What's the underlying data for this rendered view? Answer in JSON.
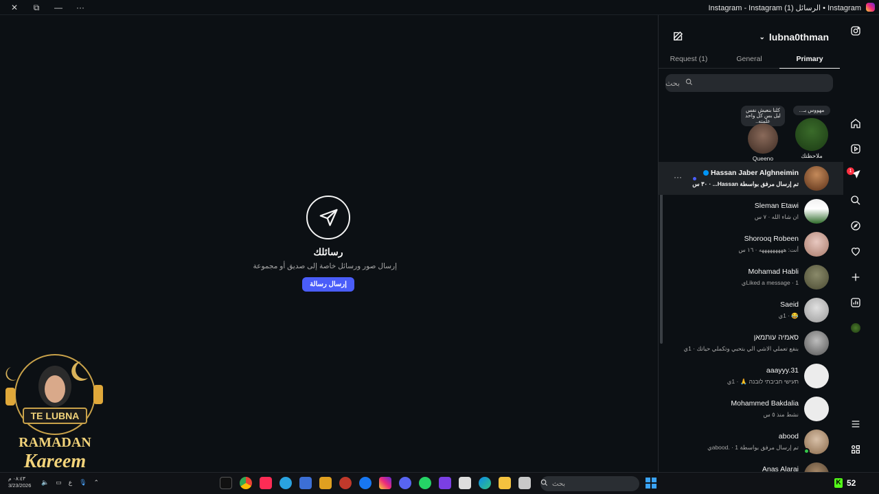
{
  "window": {
    "title": "Instagram • الرسائل (1) Instagram - Instagram",
    "controls": [
      "close",
      "restore",
      "minimize",
      "more"
    ]
  },
  "empty_state": {
    "title": "رسائلك",
    "subtitle": "إرسال صور ورسائل خاصة إلى صديق أو مجموعة",
    "button": "إرسال رسالة"
  },
  "sticker": {
    "name_banner": "TE LUBNA",
    "line1": "RAMADAN",
    "line2": "Kareem"
  },
  "inbox": {
    "username": "lubna0thman",
    "tabs": [
      {
        "label": "Primary",
        "active": true
      },
      {
        "label": "General",
        "active": false
      },
      {
        "label": "Request (1)",
        "active": false
      }
    ],
    "search_placeholder": "بحث",
    "notes": [
      {
        "bubble": "مهووس بـ...",
        "name": "ملاحظتك"
      },
      {
        "bubble": "كلنا بنعيش نفس ليل بس كل واحد علمته..",
        "name": "Queeno"
      }
    ],
    "threads": [
      {
        "name": "Hassan Jaber Alghneimin",
        "meta": "تم إرسال مرفق بواسطة Hassan... · ٣٠ س",
        "selected": true,
        "verified": true,
        "unread": true
      },
      {
        "name": "Sleman Etawi",
        "meta": "ان شاء الله · ٧ س"
      },
      {
        "name": "Shorooq Robeen",
        "meta": "أنت: هههههههههه · ١٦ س"
      },
      {
        "name": "Mohamad Habli",
        "meta": "Liked a message · 1ي"
      },
      {
        "name": "Saeid",
        "meta": "😂 · 1ي"
      },
      {
        "name": "סאמיה עותמאן",
        "meta": "بنفع تعملي الاشي الي بتحبي وتكملي حياتك · 1ي"
      },
      {
        "name": "aaayyy.31",
        "meta": "תעישי חביבתי לובנה 🙏 · 1ي"
      },
      {
        "name": "Mohammed Bakdalia",
        "meta": "نشط منذ ٥ س"
      },
      {
        "name": "abood",
        "meta": "تم إرسال مرفق بواسطة abood. · 1ي",
        "online": true
      },
      {
        "name": "Anas Alarai",
        "meta": ""
      }
    ]
  },
  "rail": {
    "icons": [
      "instagram-icon",
      "home-icon",
      "reels-icon",
      "messages-icon",
      "search-icon",
      "explore-icon",
      "heart-icon",
      "create-icon",
      "insights-icon",
      "profile-avatar",
      "menu-icon",
      "apps-icon"
    ],
    "messages_badge": "1"
  },
  "taskbar": {
    "time": "٠٨:٤٣ م",
    "date": "3/23/2026",
    "lang": "ع",
    "search_placeholder": "بحث",
    "kick_count": "52"
  }
}
